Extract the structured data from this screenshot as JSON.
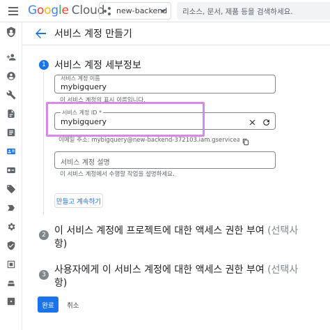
{
  "header": {
    "logo_google": "Google",
    "logo_cloud": "Cloud",
    "project_name": "new-backend",
    "search_placeholder": "리소스, 문서, 제품 등을 검색하세요."
  },
  "nav": {
    "icons": [
      "shield-icon",
      "person-add-icon",
      "account-icon",
      "wrench-icon",
      "audit-icon",
      "list-icon",
      "service-account-icon",
      "key-icon",
      "tag-icon",
      "label-icon",
      "gear-icon",
      "policy-icon",
      "workload-icon",
      "privileged-access-icon",
      "release-notes-icon"
    ],
    "active_index": 6
  },
  "page": {
    "title": "서비스 계정 만들기"
  },
  "steps": [
    {
      "number": "1",
      "title": "서비스 계정 세부정보",
      "optional": ""
    },
    {
      "number": "2",
      "title_line1": "이 서비스 계정에 프로젝트에 대한 액세스 권한 부여",
      "optional_line1": "(선택사",
      "optional_line2": "항)"
    },
    {
      "number": "3",
      "title_line1": "사용자에게 이 서비스 계정에 대한 액세스 권한 부여",
      "optional_line1": "(선택사",
      "optional_line2": "항)"
    }
  ],
  "form": {
    "name_label": "서비스 계정 이름",
    "name_value": "mybigquery",
    "name_hint": "이 서비스 계정의 표시 이름입니다.",
    "id_label": "서비스 계정 ID *",
    "id_value": "mybigquery",
    "email_hint": "이메일 주소: mybigquery@new-backend-372103.iam.gserviceaccount.com",
    "description_placeholder": "서비스 계정 설명",
    "description_hint": "이 서비스 계정에서 수행할 작업을 설명하세요.",
    "create_continue_label": "만들고 계속하기"
  },
  "footer": {
    "done_label": "완료",
    "cancel_label": "취소"
  },
  "colors": {
    "accent": "#1a73e8",
    "focus_highlight": "#d48ae6"
  }
}
